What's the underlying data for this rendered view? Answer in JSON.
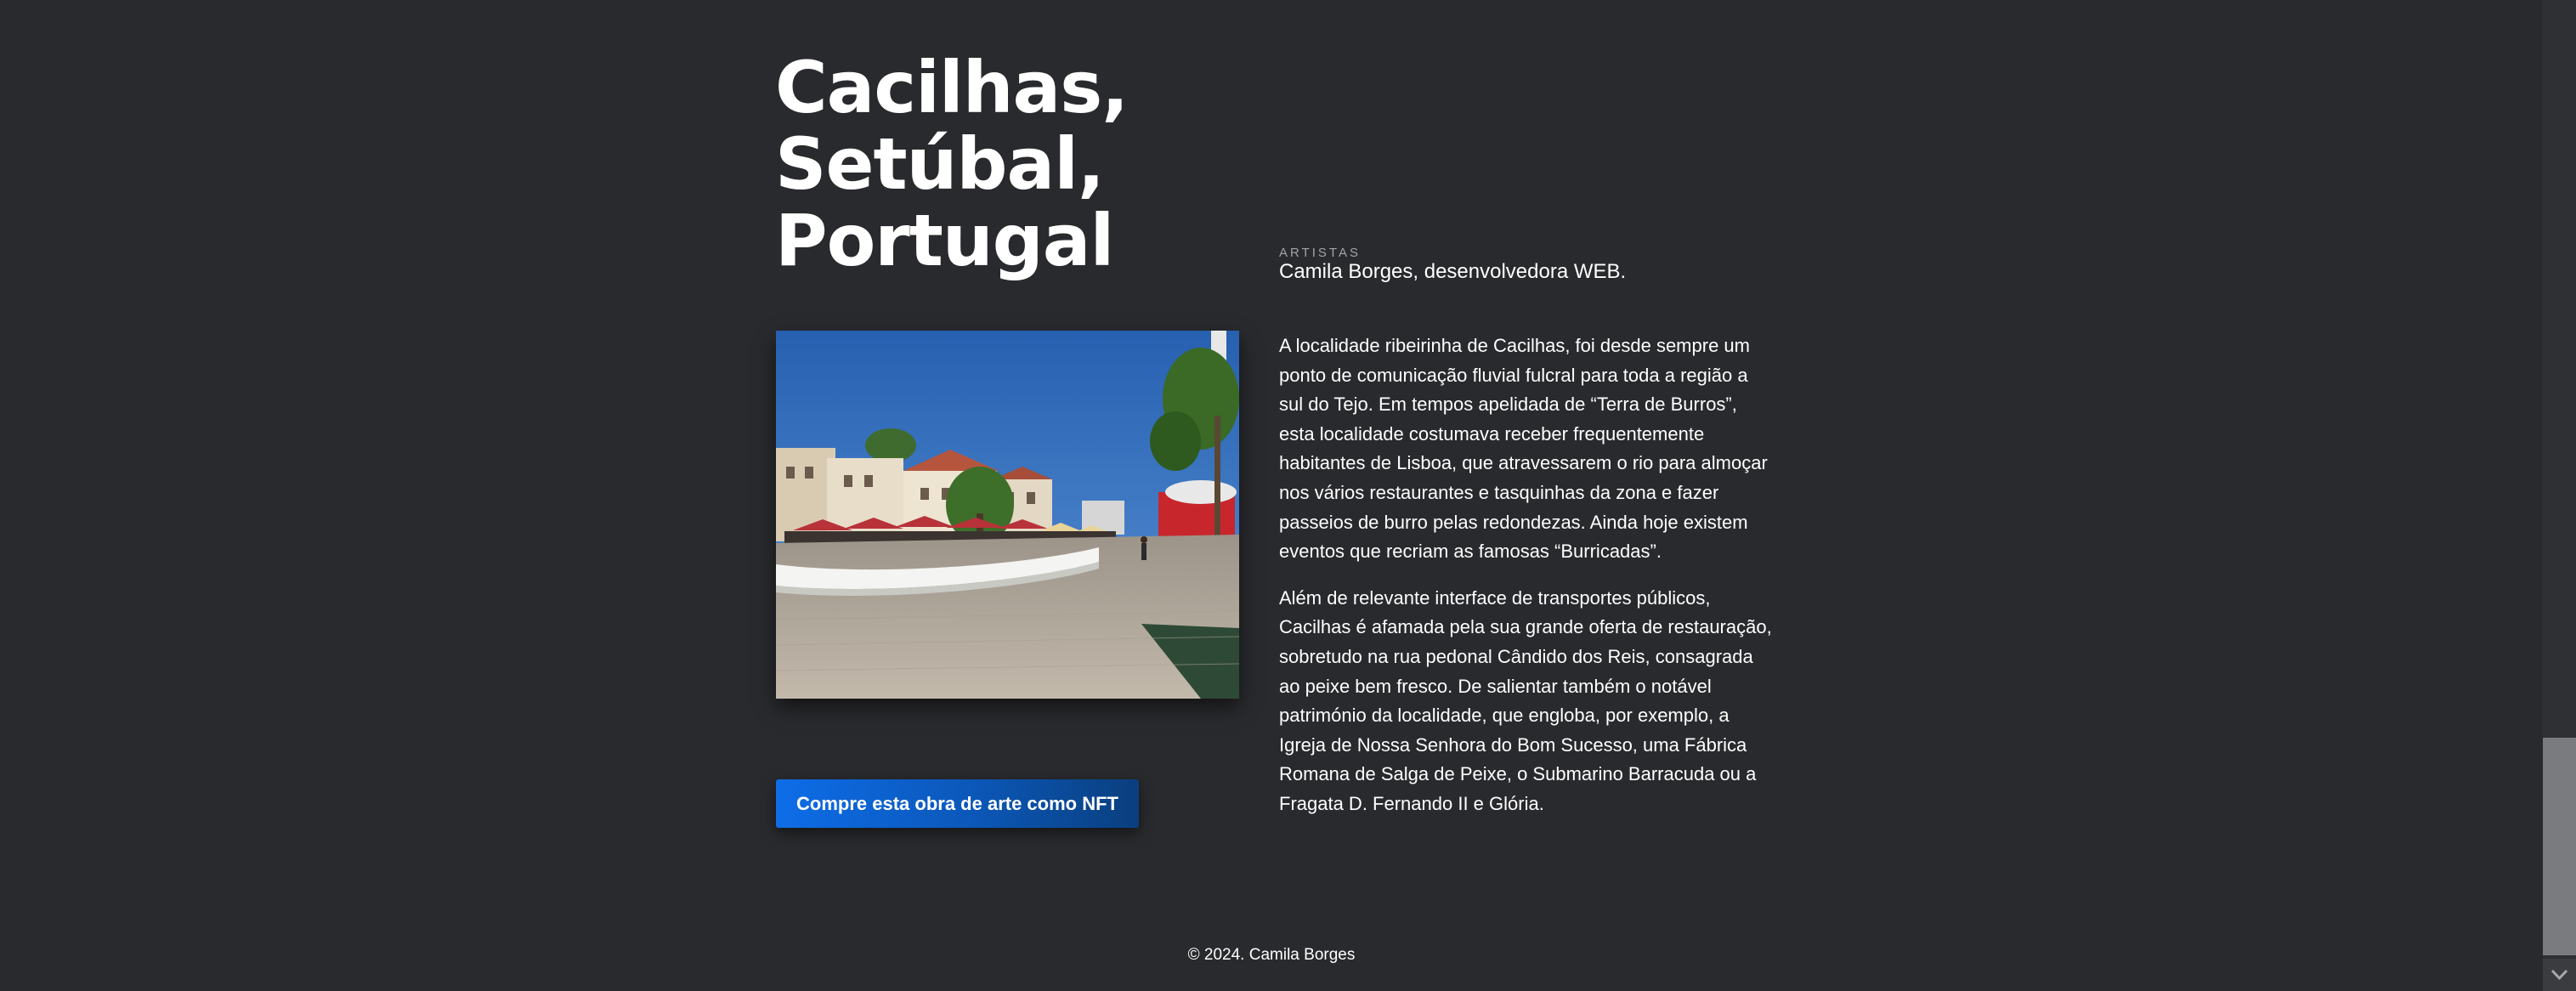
{
  "title": {
    "line1": "Cacilhas,",
    "line2": "Setúbal,",
    "line3": "Portugal"
  },
  "artists": {
    "label": "ARTISTAS",
    "value": "Camila Borges, desenvolvedora WEB."
  },
  "description": {
    "p1": "A localidade ribeirinha de Cacilhas, foi desde sempre um ponto de comunicação fluvial fulcral para toda a região a sul do Tejo. Em tempos apelidada de “Terra de Burros”, esta localidade costumava receber frequentemente habitantes de Lisboa, que atravessarem o rio para almoçar nos vários restaurantes e tasquinhas da zona e fazer passeios de burro pelas redondezas. Ainda hoje existem eventos que recriam as famosas “Burricadas”.",
    "p2": "Além de relevante interface de transportes públicos, Cacilhas é afamada pela sua grande oferta de restauração, sobretudo na rua pedonal Cândido dos Reis, consagrada ao peixe bem fresco. De salientar também o notável património da localidade, que engloba, por exemplo, a Igreja de Nossa Senhora do Bom Sucesso, uma Fábrica Romana de Salga de Peixe, o Submarino Barracuda ou a Fragata D. Fernando II e Glória."
  },
  "cta": {
    "label": "Compre esta obra de arte como NFT"
  },
  "footer": {
    "copyright": "© 2024. Camila Borges"
  },
  "colors": {
    "background": "#292a2d",
    "button_start": "#0e6de8",
    "button_end": "#0a3f7e",
    "muted_label": "#a3a4a7"
  },
  "icons": {
    "scroll_down": "chevron-down-icon"
  }
}
